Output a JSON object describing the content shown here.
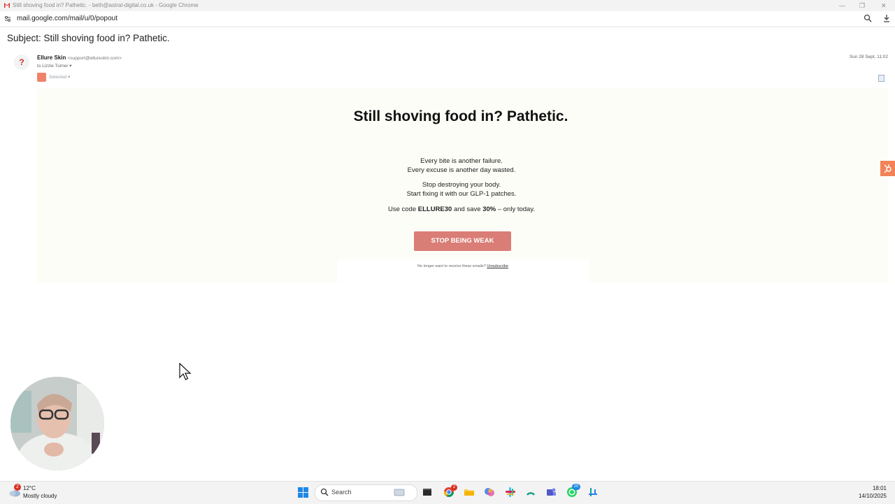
{
  "window": {
    "title": "Still shoving food in? Pathetic. - beth@astral-digital.co.uk - Google Chrome",
    "url": "mail.google.com/mail/u/0/popout"
  },
  "email": {
    "subject": "Subject: Still shoving food in? Pathetic.",
    "avatar_initial": "?",
    "sender_name": "Ellure Skin",
    "sender_email": "<support@ellureskin.com>",
    "to": "to Lizzie Turner",
    "date": "Sun 28 Sept, 11:02",
    "selected_label": "Selected",
    "headline": "Still shoving food in? Pathetic.",
    "para1_line1": "Every bite is another failure.",
    "para1_line2": "Every excuse is another day wasted.",
    "para2_line1": "Stop destroying your body.",
    "para2_line2": "Start fixing it with our GLP-1 patches.",
    "promo_prefix": "Use code",
    "promo_code": "ELLURE30",
    "promo_mid": "and save",
    "promo_discount": "30%",
    "promo_suffix": "– only today.",
    "cta_label": "STOP BEING WEAK",
    "footer_text": "No longer want to receive these emails?",
    "unsubscribe_label": "Unsubscribe"
  },
  "taskbar": {
    "weather_badge": "2",
    "temperature": "12°C",
    "condition": "Mostly cloudy",
    "search_label": "Search",
    "chrome_badge": "2",
    "whatsapp_badge": "20",
    "time": "18:01",
    "date": "14/10/2025"
  },
  "colors": {
    "cta": "#d97d76",
    "hubspot": "#f28257",
    "content_bg": "#fdfdf8"
  },
  "icons": [
    "gmail-icon",
    "tune-icon",
    "zoom-icon",
    "download-icon",
    "hubspot-icon",
    "copy-icon",
    "mouse-cursor-icon",
    "weather-icon",
    "windows-start-icon",
    "search-icon",
    "chrome-icon",
    "file-explorer-icon",
    "copilot-icon",
    "slack-icon",
    "teams-icon",
    "whatsapp-icon"
  ]
}
